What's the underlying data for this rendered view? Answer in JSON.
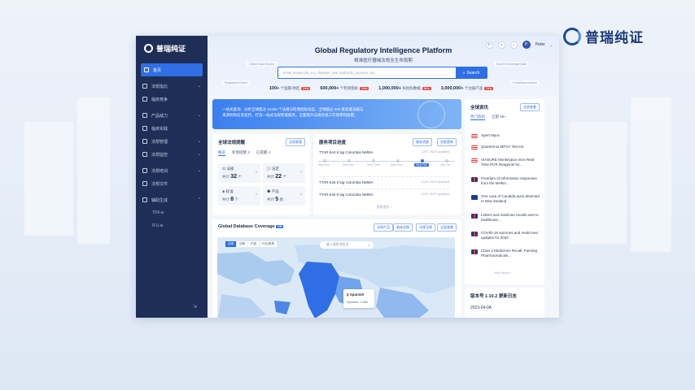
{
  "corner_brand": "普瑞纯证",
  "sidebar": {
    "brand": "普瑞纯证",
    "items": [
      {
        "label": "首页",
        "icon": "home-icon",
        "active": true
      },
      {
        "label": "法规指北",
        "icon": "book-icon",
        "chevron": true
      },
      {
        "label": "临床竞争",
        "icon": "chart-icon"
      },
      {
        "label": "产品威力",
        "icon": "box-icon",
        "chevron": true
      },
      {
        "label": "临床实践",
        "icon": "flask-icon"
      },
      {
        "label": "法规管理",
        "icon": "doc-icon",
        "chevron": true
      },
      {
        "label": "法规监控",
        "icon": "eye-icon",
        "chevron": true
      },
      {
        "label": "法规培训",
        "icon": "edu-icon",
        "chevron": true
      },
      {
        "label": "法规文件",
        "icon": "file-icon"
      },
      {
        "label": "辅助生成",
        "icon": "magic-icon",
        "chevron": true
      },
      {
        "label": "TDF.ai",
        "sub": true
      },
      {
        "label": "IFU.ai",
        "sub": true
      }
    ],
    "collapse_glyph": "⇲"
  },
  "header": {
    "title": "Global Regulatory Intelligence Platform",
    "subtitle": "精准医疗器械法规全生命周期",
    "search_placeholder": "Enter keywords, e.g. disease, test methods, sponsor, etc.",
    "search_button": "Search",
    "user_initial": "P",
    "user_name": "Peter",
    "float_tags": [
      "Global Data Monitor",
      "Regulatory Expert",
      "Expert Knowledge Base",
      "Compliance Advice"
    ]
  },
  "stats": [
    {
      "value": "100+",
      "label": "个国家/地区",
      "badge": "New"
    },
    {
      "value": "600,000+",
      "label": "个检测指标",
      "badge": "New"
    },
    {
      "value": "1,000,000+",
      "label": "条指标数据",
      "badge": "New"
    },
    {
      "value": "3,000,000+",
      "label": "个注册产品",
      "badge": "New"
    }
  ],
  "banner": {
    "line1": "一站式查询、分析全球超过 12400 个法规与检测指标动态、全球超过 200 家权威法规与",
    "line2": "来源机构信息监控，打造一站式法规智能服务，全面提升法规合规工作效率和质量。"
  },
  "watch": {
    "title": "全球法规提醒",
    "button": "全部查看",
    "tabs": [
      "概览",
      "新增提醒 3",
      "已提醒 4"
    ],
    "boxes": [
      {
        "label": "法规",
        "prefix": "共计",
        "count": "32",
        "unit": "个"
      },
      {
        "label": "法定",
        "prefix": "共计",
        "count": "22",
        "unit": "个"
      },
      {
        "label": "标准",
        "prefix": "共计",
        "count": "8",
        "unit": "个"
      },
      {
        "label": "产品",
        "prefix": "共计",
        "count": "5",
        "unit": "款"
      }
    ]
  },
  "progress": {
    "title": "服务项目进度",
    "buttons": [
      "服务进度",
      "进度更新"
    ],
    "tasks": [
      {
        "name": "TTAR-544 6 lag Columbia NMMA",
        "date": "12/27 2023 Updated"
      },
      {
        "name": "TTAR-545 6 lag Columbia NMMA",
        "date": "12/27 2023 Updated"
      },
      {
        "name": "TTAR-545 6 lag Columbia NMMA",
        "date": "12/27 2023 Updated"
      }
    ],
    "steps": [
      "Step One",
      "Step Two",
      "Step Three",
      "Step Four",
      "Step Five",
      "Step Six"
    ],
    "active_step": 5,
    "more": "查看更多 >"
  },
  "coverage": {
    "title": "Global Database Coverage",
    "badge": "Off",
    "buttons": [
      "全球产品",
      "临床实践",
      "法规法规",
      "全面查看"
    ],
    "map_tabs": [
      "全球",
      "法规",
      "产品",
      "行业/机构"
    ],
    "map_search": "输入国家/地区名",
    "tooltip_country": "Spanish",
    "tooltip_value": "Speaker: 1.356"
  },
  "news": {
    "title": "全球资讯",
    "button": "全部查看",
    "tabs": [
      "热门资讯",
      "全部 99+"
    ],
    "items": [
      {
        "flag": "us",
        "text": "Xpert Mpox"
      },
      {
        "flag": "us",
        "text": "QuantVirus MPXV Test Kit"
      },
      {
        "flag": "us",
        "text": "VIASURE Monkeypox virus Real Time PCR Reagents for..."
      },
      {
        "flag": "uk",
        "text": "Freedom of Information responses from the MHRA..."
      },
      {
        "flag": "nz",
        "text": "One case of Candida auris detected in New Zealand"
      },
      {
        "flag": "uk",
        "text": "Letters and medicine recalls sent to healthcare..."
      },
      {
        "flag": "uk",
        "text": "COVID-19 vaccines and medicines: updates for 2023"
      },
      {
        "flag": "uk",
        "text": "Class 2 Medicines Recall: Fanning Pharmaceuticals..."
      }
    ],
    "more": "View More >"
  },
  "version": {
    "title": "版本号 1.10.2 更新日志",
    "date": "2023-04-0A"
  },
  "colors": {
    "accent": "#2f6ee5",
    "sidebar": "#1e2e57",
    "badge": "#e94a3c"
  }
}
